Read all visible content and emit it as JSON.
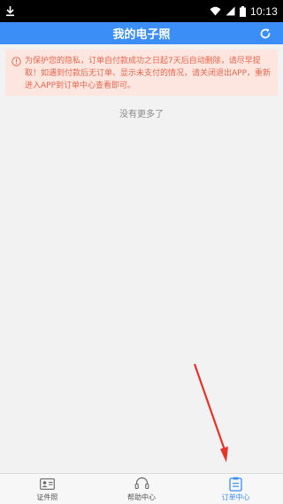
{
  "status_bar": {
    "time": "10:13"
  },
  "header": {
    "title": "我的电子照"
  },
  "notice": {
    "text": "为保护您的隐私，订单自付款成功之日起7天后自动删除，请尽早提取！如遇到付款后无订单、显示未支付的情况，请关闭退出APP，重新进入APP到订单中心查看即可。"
  },
  "main": {
    "empty_text": "没有更多了"
  },
  "bottom_nav": {
    "items": [
      {
        "label": "证件照",
        "icon": "id-card-icon",
        "active": false
      },
      {
        "label": "帮助中心",
        "icon": "headset-icon",
        "active": false
      },
      {
        "label": "订单中心",
        "icon": "clipboard-icon",
        "active": true
      }
    ]
  },
  "colors": {
    "accent": "#3a8ef6",
    "notice_bg": "#fde6e0",
    "notice_text": "#e8664d",
    "arrow": "#e8332a"
  }
}
